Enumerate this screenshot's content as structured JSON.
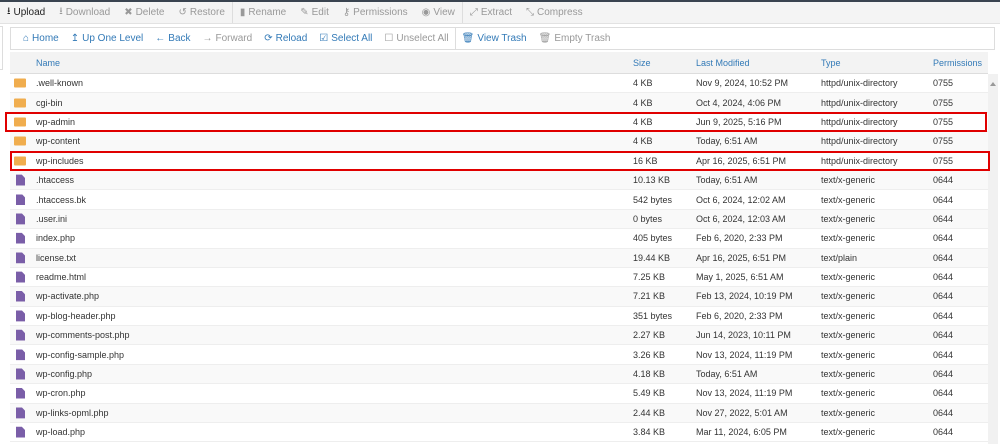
{
  "toolbar": [
    {
      "label": "Upload",
      "icon": "upload-icon",
      "glyph": "⭳",
      "active": true
    },
    {
      "label": "Download",
      "icon": "download-icon",
      "glyph": "⭳",
      "active": false
    },
    {
      "label": "Delete",
      "icon": "delete-icon",
      "glyph": "✖",
      "active": false
    },
    {
      "label": "Restore",
      "icon": "restore-icon",
      "glyph": "↺",
      "active": false
    },
    {
      "label": "Rename",
      "icon": "rename-icon",
      "glyph": "▮",
      "active": false,
      "sep": true
    },
    {
      "label": "Edit",
      "icon": "edit-icon",
      "glyph": "✎",
      "active": false
    },
    {
      "label": "Permissions",
      "icon": "key-icon",
      "glyph": "⚷",
      "active": false
    },
    {
      "label": "View",
      "icon": "eye-icon",
      "glyph": "◉",
      "active": false
    },
    {
      "label": "Extract",
      "icon": "extract-icon",
      "glyph": "⤢",
      "active": false,
      "sep": true
    },
    {
      "label": "Compress",
      "icon": "compress-icon",
      "glyph": "⤡",
      "active": false
    }
  ],
  "nav": [
    {
      "label": "Home",
      "icon": "home-icon",
      "glyph": "⌂",
      "enabled": true
    },
    {
      "label": "Up One Level",
      "icon": "up-level-icon",
      "glyph": "↥",
      "enabled": true
    },
    {
      "label": "Back",
      "icon": "back-arrow-icon",
      "glyph": "←",
      "enabled": true
    },
    {
      "label": "Forward",
      "icon": "forward-arrow-icon",
      "glyph": "→",
      "enabled": false
    },
    {
      "label": "Reload",
      "icon": "reload-icon",
      "glyph": "⟳",
      "enabled": true
    },
    {
      "label": "Select All",
      "icon": "checkbox-checked-icon",
      "glyph": "☑",
      "enabled": true
    },
    {
      "label": "Unselect All",
      "icon": "checkbox-empty-icon",
      "glyph": "☐",
      "enabled": false
    },
    {
      "label": "View Trash",
      "icon": "trash-icon",
      "glyph": "🗑",
      "enabled": true,
      "sep": true
    },
    {
      "label": "Empty Trash",
      "icon": "trash-icon",
      "glyph": "🗑",
      "enabled": false
    }
  ],
  "columns": [
    "Name",
    "Size",
    "Last Modified",
    "Type",
    "Permissions"
  ],
  "files": [
    {
      "kind": "folder",
      "name": ".well-known",
      "size": "4 KB",
      "modified": "Nov 9, 2024, 10:52 PM",
      "type": "httpd/unix-directory",
      "perms": "0755"
    },
    {
      "kind": "folder",
      "name": "cgi-bin",
      "size": "4 KB",
      "modified": "Oct 4, 2024, 4:06 PM",
      "type": "httpd/unix-directory",
      "perms": "0755"
    },
    {
      "kind": "folder",
      "name": "wp-admin",
      "size": "4 KB",
      "modified": "Jun 9, 2025, 5:16 PM",
      "type": "httpd/unix-directory",
      "perms": "0755",
      "highlight": true
    },
    {
      "kind": "folder",
      "name": "wp-content",
      "size": "4 KB",
      "modified": "Today, 6:51 AM",
      "type": "httpd/unix-directory",
      "perms": "0755"
    },
    {
      "kind": "folder",
      "name": "wp-includes",
      "size": "16 KB",
      "modified": "Apr 16, 2025, 6:51 PM",
      "type": "httpd/unix-directory",
      "perms": "0755",
      "highlight": true
    },
    {
      "kind": "file",
      "name": ".htaccess",
      "size": "10.13 KB",
      "modified": "Today, 6:51 AM",
      "type": "text/x-generic",
      "perms": "0644"
    },
    {
      "kind": "file",
      "name": ".htaccess.bk",
      "size": "542 bytes",
      "modified": "Oct 6, 2024, 12:02 AM",
      "type": "text/x-generic",
      "perms": "0644"
    },
    {
      "kind": "file",
      "name": ".user.ini",
      "size": "0 bytes",
      "modified": "Oct 6, 2024, 12:03 AM",
      "type": "text/x-generic",
      "perms": "0644"
    },
    {
      "kind": "file",
      "name": "index.php",
      "size": "405 bytes",
      "modified": "Feb 6, 2020, 2:33 PM",
      "type": "text/x-generic",
      "perms": "0644"
    },
    {
      "kind": "file",
      "name": "license.txt",
      "size": "19.44 KB",
      "modified": "Apr 16, 2025, 6:51 PM",
      "type": "text/plain",
      "perms": "0644"
    },
    {
      "kind": "file",
      "name": "readme.html",
      "size": "7.25 KB",
      "modified": "May 1, 2025, 6:51 AM",
      "type": "text/x-generic",
      "perms": "0644"
    },
    {
      "kind": "file",
      "name": "wp-activate.php",
      "size": "7.21 KB",
      "modified": "Feb 13, 2024, 10:19 PM",
      "type": "text/x-generic",
      "perms": "0644"
    },
    {
      "kind": "file",
      "name": "wp-blog-header.php",
      "size": "351 bytes",
      "modified": "Feb 6, 2020, 2:33 PM",
      "type": "text/x-generic",
      "perms": "0644"
    },
    {
      "kind": "file",
      "name": "wp-comments-post.php",
      "size": "2.27 KB",
      "modified": "Jun 14, 2023, 10:11 PM",
      "type": "text/x-generic",
      "perms": "0644"
    },
    {
      "kind": "file",
      "name": "wp-config-sample.php",
      "size": "3.26 KB",
      "modified": "Nov 13, 2024, 11:19 PM",
      "type": "text/x-generic",
      "perms": "0644"
    },
    {
      "kind": "file",
      "name": "wp-config.php",
      "size": "4.18 KB",
      "modified": "Today, 6:51 AM",
      "type": "text/x-generic",
      "perms": "0644"
    },
    {
      "kind": "file",
      "name": "wp-cron.php",
      "size": "5.49 KB",
      "modified": "Nov 13, 2024, 11:19 PM",
      "type": "text/x-generic",
      "perms": "0644"
    },
    {
      "kind": "file",
      "name": "wp-links-opml.php",
      "size": "2.44 KB",
      "modified": "Nov 27, 2022, 5:01 AM",
      "type": "text/x-generic",
      "perms": "0644"
    },
    {
      "kind": "file",
      "name": "wp-load.php",
      "size": "3.84 KB",
      "modified": "Mar 11, 2024, 6:05 PM",
      "type": "text/x-generic",
      "perms": "0644"
    }
  ]
}
